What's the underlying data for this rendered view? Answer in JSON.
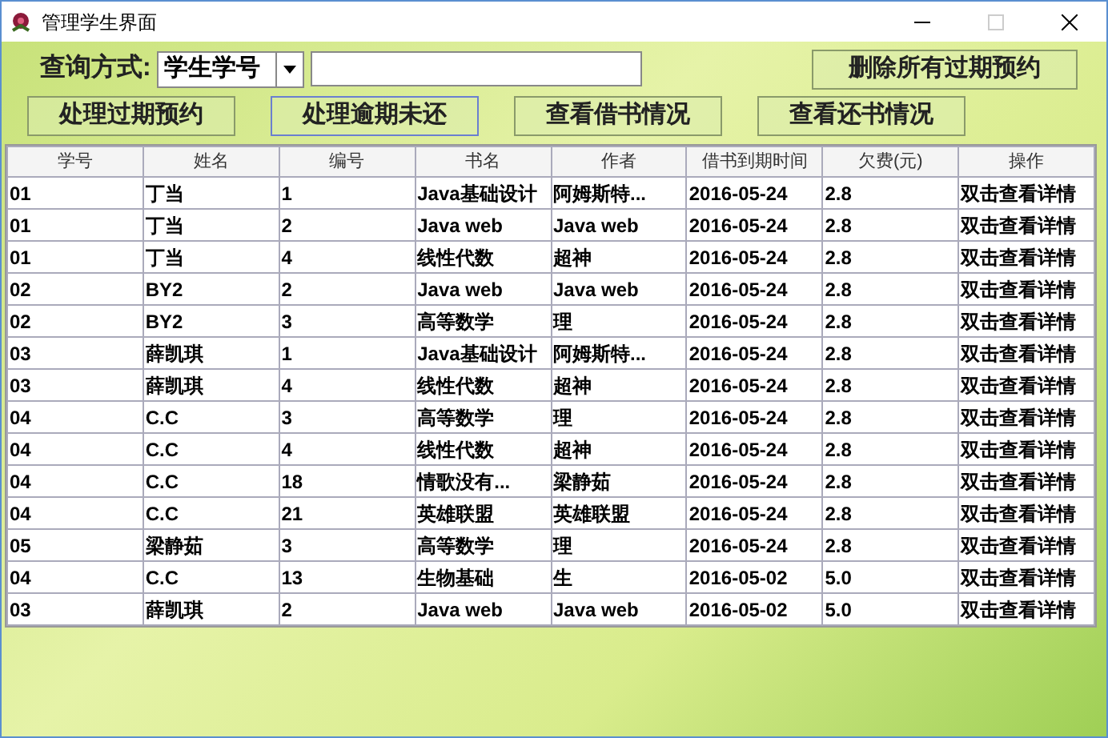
{
  "window": {
    "title": "管理学生界面"
  },
  "query": {
    "label": "查询方式:",
    "dropdown_value": "学生学号"
  },
  "buttons": [
    {
      "label": "删除所有过期预约",
      "focused": false
    },
    {
      "label": "处理过期预约",
      "focused": false
    },
    {
      "label": "处理逾期未还",
      "focused": true
    },
    {
      "label": "查看借书情况",
      "focused": false
    },
    {
      "label": "查看还书情况",
      "focused": false
    }
  ],
  "table": {
    "columns": [
      "学号",
      "姓名",
      "编号",
      "书名",
      "作者",
      "借书到期时间",
      "欠费(元)",
      "操作"
    ],
    "rows": [
      [
        "01",
        "丁当",
        "1",
        "Java基础设计",
        "阿姆斯特...",
        "2016-05-24",
        "2.8",
        "双击查看详情"
      ],
      [
        "01",
        "丁当",
        "2",
        "Java web",
        "Java web",
        "2016-05-24",
        "2.8",
        "双击查看详情"
      ],
      [
        "01",
        "丁当",
        "4",
        "线性代数",
        "超神",
        "2016-05-24",
        "2.8",
        "双击查看详情"
      ],
      [
        "02",
        "BY2",
        "2",
        "Java web",
        "Java web",
        "2016-05-24",
        "2.8",
        "双击查看详情"
      ],
      [
        "02",
        "BY2",
        "3",
        "高等数学",
        "理",
        "2016-05-24",
        "2.8",
        "双击查看详情"
      ],
      [
        "03",
        "薛凯琪",
        "1",
        "Java基础设计",
        "阿姆斯特...",
        "2016-05-24",
        "2.8",
        "双击查看详情"
      ],
      [
        "03",
        "薛凯琪",
        "4",
        "线性代数",
        "超神",
        "2016-05-24",
        "2.8",
        "双击查看详情"
      ],
      [
        "04",
        "C.C",
        "3",
        "高等数学",
        "理",
        "2016-05-24",
        "2.8",
        "双击查看详情"
      ],
      [
        "04",
        "C.C",
        "4",
        "线性代数",
        "超神",
        "2016-05-24",
        "2.8",
        "双击查看详情"
      ],
      [
        "04",
        "C.C",
        "18",
        "情歌没有...",
        "梁静茹",
        "2016-05-24",
        "2.8",
        "双击查看详情"
      ],
      [
        "04",
        "C.C",
        "21",
        "英雄联盟",
        "英雄联盟",
        "2016-05-24",
        "2.8",
        "双击查看详情"
      ],
      [
        "05",
        "梁静茹",
        "3",
        "高等数学",
        "理",
        "2016-05-24",
        "2.8",
        "双击查看详情"
      ],
      [
        "04",
        "C.C",
        "13",
        "生物基础",
        "生",
        "2016-05-02",
        "5.0",
        "双击查看详情"
      ],
      [
        "03",
        "薛凯琪",
        "2",
        "Java web",
        "Java web",
        "2016-05-02",
        "5.0",
        "双击查看详情"
      ]
    ]
  }
}
